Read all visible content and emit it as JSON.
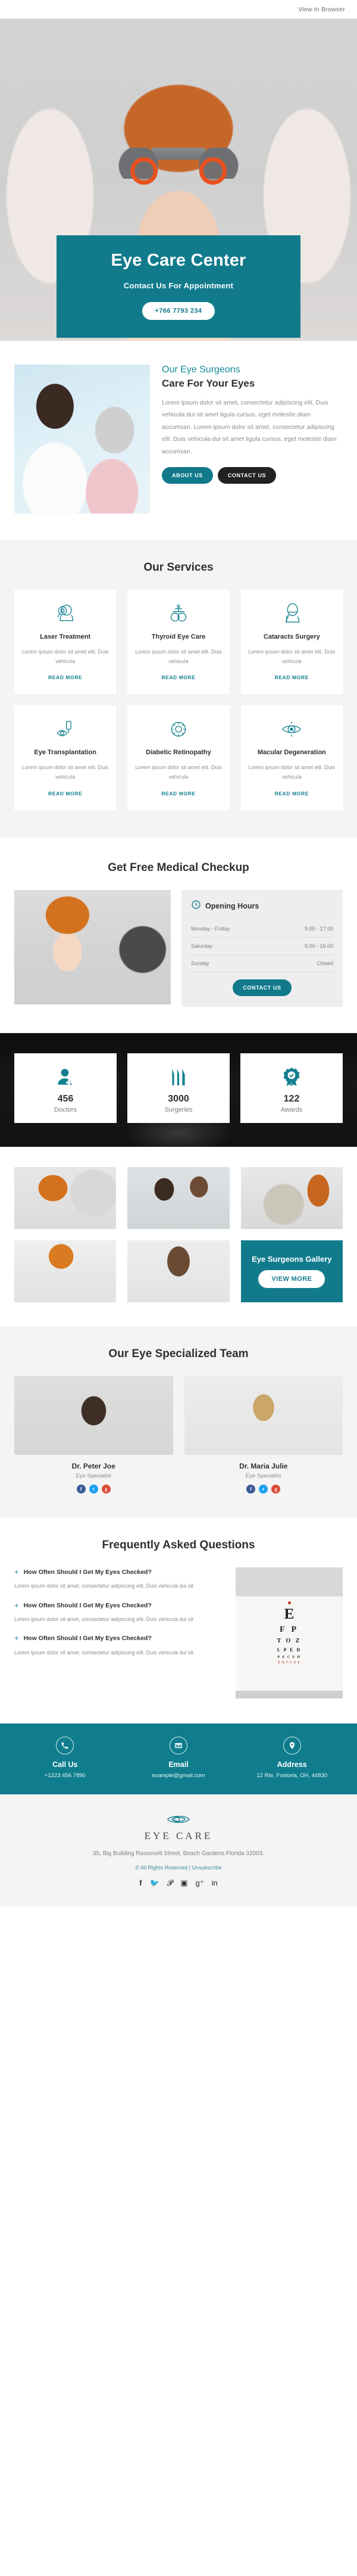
{
  "topbar": {
    "view_in_browser": "View In Browser"
  },
  "hero": {
    "title": "Eye Care Center",
    "subtitle": "Contact Us For Appointment",
    "phone_button": "+766 7793 234"
  },
  "about": {
    "eyebrow": "Our Eye Surgeons",
    "title": "Care For Your Eyes",
    "paragraph": "Lorem ipsum dolor sit amet, consectetur adipiscing elit. Duis vehicula dui sit amet ligula cursus, eget molestie diam accumsan. Lorem ipsum dolor sit amet, consectetur adipiscing elit. Duis vehicula dui sit amet ligula cursus, eget molestie diam accumsan.",
    "btn_about": "ABOUT US",
    "btn_contact": "CONTACT US"
  },
  "services": {
    "title": "Our Services",
    "read_more": "READ MORE",
    "items": [
      {
        "icon": "eye-exam-icon",
        "title": "Laser Treatment",
        "text": "Lorem ipsum dolor sit amet elit. Duis vehicula"
      },
      {
        "icon": "phoropter-icon",
        "title": "Thyroid Eye Care",
        "text": "Lorem ipsum dolor sit amet elit. Duis vehicula"
      },
      {
        "icon": "surgery-patient-icon",
        "title": "Cataracts Surgery",
        "text": "Lorem ipsum dolor sit amet elit. Duis vehicula"
      },
      {
        "icon": "eye-drops-icon",
        "title": "Eye Transplantation",
        "text": "Lorem ipsum dolor sit amet elit. Duis vehicula"
      },
      {
        "icon": "retina-icon",
        "title": "Diabetic Retinopathy",
        "text": "Lorem ipsum dolor sit amet elit. Duis vehicula"
      },
      {
        "icon": "macula-icon",
        "title": "Macular Degeneration",
        "text": "Lorem ipsum dolor sit amet elit. Duis vehicula"
      }
    ]
  },
  "checkup": {
    "title": "Get Free Medical Checkup",
    "hours_title": "Opening Hours",
    "rows": [
      {
        "day": "Monday - Friday",
        "time": "9.00 - 17.00"
      },
      {
        "day": "Saturday",
        "time": "9.00 - 16.00"
      },
      {
        "day": "Sunday",
        "time": "Closed"
      }
    ],
    "cta": "CONTACT US"
  },
  "stats": [
    {
      "icon": "doctor-icon",
      "number": "456",
      "label": "Doctors"
    },
    {
      "icon": "scalpel-icon",
      "number": "3000",
      "label": "Surgeries"
    },
    {
      "icon": "award-icon",
      "number": "122",
      "label": "Awards"
    }
  ],
  "gallery": {
    "cta_title": "Eye Surgeons Gallery",
    "cta_button": "VIEW MORE"
  },
  "team": {
    "title": "Our Eye Specialized Team",
    "members": [
      {
        "name": "Dr. Peter Joe",
        "role": "Eye Specialist"
      },
      {
        "name": "Dr. Maria Julie",
        "role": "Eye Specialist"
      }
    ],
    "social_icons": [
      "facebook-icon",
      "twitter-icon",
      "google-plus-icon"
    ]
  },
  "faq": {
    "title": "Frequently Asked Questions",
    "items": [
      {
        "question": "How Often Should I Get My Eyes Checked?",
        "answer": "Lorem ipsum dolor sit amet, consectetur adipiscing elit. Duis vehicula dui sit"
      },
      {
        "question": "How Often Should I Get My Eyes Checked?",
        "answer": "Lorem ipsum dolor sit amet, consectetur adipiscing elit. Duis vehicula dui sit"
      },
      {
        "question": "How Often Should I Get My Eyes Checked?",
        "answer": "Lorem ipsum dolor sit amet, consectetur adipiscing elit. Duis vehicula dui sit"
      }
    ],
    "eye_chart": {
      "row1": "E",
      "row2": "F P",
      "row3": "T O Z",
      "row4": "L P E D",
      "row5": "P E C F D",
      "row6": "E D F C Z P"
    }
  },
  "contact": [
    {
      "icon": "phone-icon",
      "title": "Call Us",
      "value": "+1223 456 7890"
    },
    {
      "icon": "envelope-icon",
      "title": "Email",
      "value": "example@gmail.com"
    },
    {
      "icon": "location-pin-icon",
      "title": "Address",
      "value": "12 Rte, Fostoria, OH, 44830"
    }
  ],
  "footer": {
    "logo_text": "EYE CARE",
    "address": "35, Big Building Roosevelt Street, Beach Gardens Florida 32003.",
    "rights": "© All Rights Reserved | Unsubscribe",
    "socials": [
      "facebook-icon",
      "twitter-icon",
      "pinterest-icon",
      "instagram-icon",
      "google-plus-icon",
      "linkedin-icon"
    ]
  },
  "colors": {
    "teal": "#11798b",
    "dark": "#222222",
    "gray_bg": "#f4f4f4"
  }
}
